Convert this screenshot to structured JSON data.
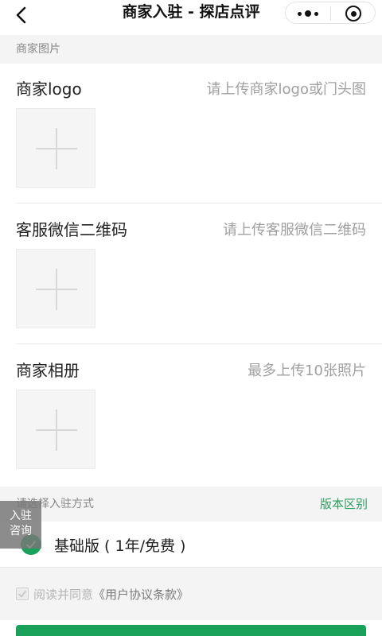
{
  "nav": {
    "title": "商家入驻 - 探店点评"
  },
  "sections": {
    "photos_title": "商家图片",
    "method_title": "请选择入驻方式",
    "method_link": "版本区别"
  },
  "uploads": [
    {
      "label": "商家logo",
      "hint": "请上传商家logo或门头图"
    },
    {
      "label": "客服微信二维码",
      "hint": "请上传客服微信二维码"
    },
    {
      "label": "商家相册",
      "hint": "最多上传10张照片"
    }
  ],
  "plan": {
    "label": "基础版 ( 1年/免费 )",
    "selected": true
  },
  "agreement": {
    "prefix": "阅读并同意",
    "link": "《用户协议条款》",
    "checked": true
  },
  "float_tab": {
    "line1": "入驻",
    "line2": "咨询"
  },
  "colors": {
    "accent": "#1aa25a",
    "link_green": "#2e9e5f"
  }
}
